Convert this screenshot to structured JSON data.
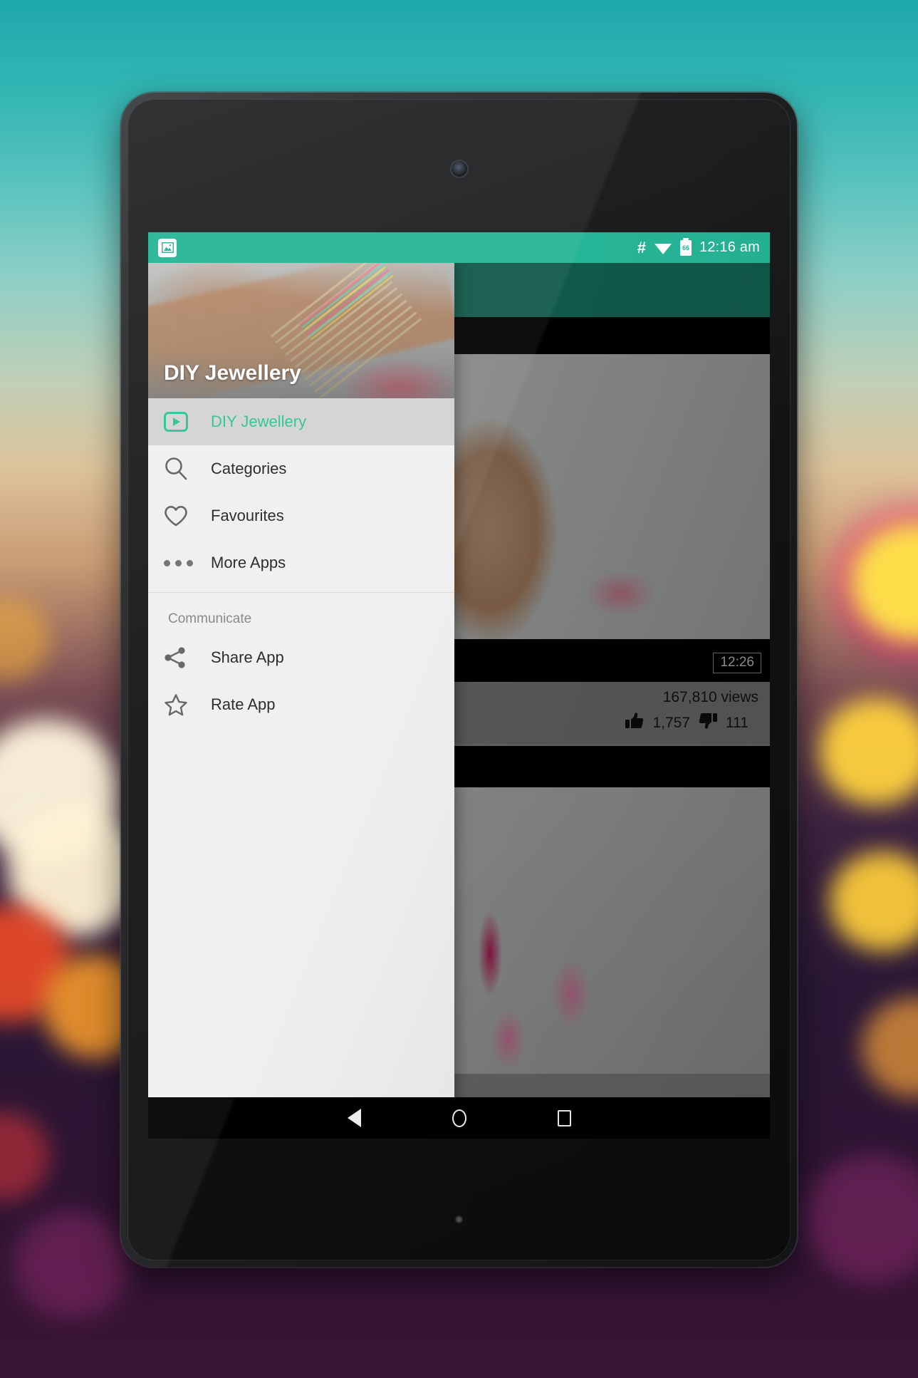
{
  "device": {
    "name": "android-tablet",
    "camera_icon": "camera-icon",
    "home_indicator": "home-dot"
  },
  "status_bar": {
    "app_icon": "image-icon",
    "hash_icon": "hash-icon",
    "wifi_icon": "wifi-icon",
    "battery_icon": "battery-icon",
    "battery_level": "66",
    "clock": "12:16 am",
    "background_color": "#26b596"
  },
  "drawer": {
    "header_title": "DIY Jewellery",
    "items": [
      {
        "label": "DIY Jewellery",
        "icon": "play-box-icon",
        "selected": true
      },
      {
        "label": "Categories",
        "icon": "search-icon",
        "selected": false
      },
      {
        "label": "Favourites",
        "icon": "heart-icon",
        "selected": false
      },
      {
        "label": "More Apps",
        "icon": "more-dots-icon",
        "selected": false
      }
    ],
    "section_label": "Communicate",
    "section_items": [
      {
        "label": "Share App",
        "icon": "share-icon"
      },
      {
        "label": "Rate App",
        "icon": "star-icon"
      }
    ],
    "selected_color": "#2ec295",
    "background_color": "#efefef"
  },
  "content": {
    "toolbar_color": "#1c9077",
    "videos": [
      {
        "thumbnail": "woman-wearing-pink-safety-pin-bracelet",
        "duration": "12:26",
        "views": "167,810 views",
        "likes": "1,757",
        "dislikes": "111",
        "like_icon": "thumbs-up-icon",
        "dislike_icon": "thumbs-down-icon"
      },
      {
        "thumbnail": "pink-beaded-tassel-necklace",
        "duration": "",
        "views": "",
        "likes": "",
        "dislikes": ""
      }
    ]
  },
  "navbar": {
    "buttons": [
      {
        "name": "back",
        "icon": "back-triangle-icon"
      },
      {
        "name": "home",
        "icon": "home-circle-icon"
      },
      {
        "name": "recents",
        "icon": "recents-square-icon"
      }
    ]
  }
}
